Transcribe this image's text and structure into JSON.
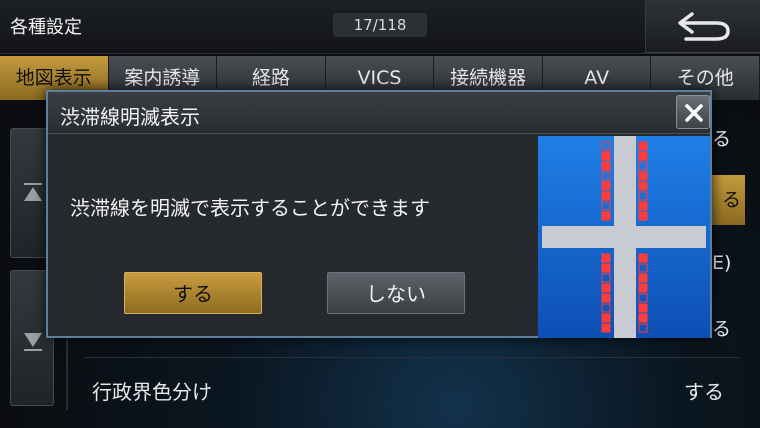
{
  "header": {
    "title": "各種設定",
    "page_indicator": "17/118"
  },
  "tabs": [
    {
      "label": "地図表示",
      "active": true
    },
    {
      "label": "案内誘導",
      "active": false
    },
    {
      "label": "経路",
      "active": false
    },
    {
      "label": "VICS",
      "active": false
    },
    {
      "label": "接続機器",
      "active": false
    },
    {
      "label": "AV",
      "active": false
    },
    {
      "label": "その他",
      "active": false
    }
  ],
  "background_list": {
    "partial_values": [
      "る",
      "る",
      "E)",
      "る"
    ],
    "last_row": {
      "label": "行政界色分け",
      "value": "する"
    }
  },
  "dialog": {
    "title": "渋滞線明滅表示",
    "message": "渋滞線を明滅で表示することができます",
    "yes_label": "する",
    "no_label": "しない"
  },
  "colors": {
    "accent": "#c49a3c",
    "dialog_border": "#5b7f9f",
    "congestion_red": "#ff3b3b",
    "preview_blue": "#1f7fe6"
  },
  "icons": {
    "back": "back-arrow-icon",
    "close": "close-icon",
    "scroll_up": "scroll-up-icon",
    "scroll_down": "scroll-down-icon"
  }
}
